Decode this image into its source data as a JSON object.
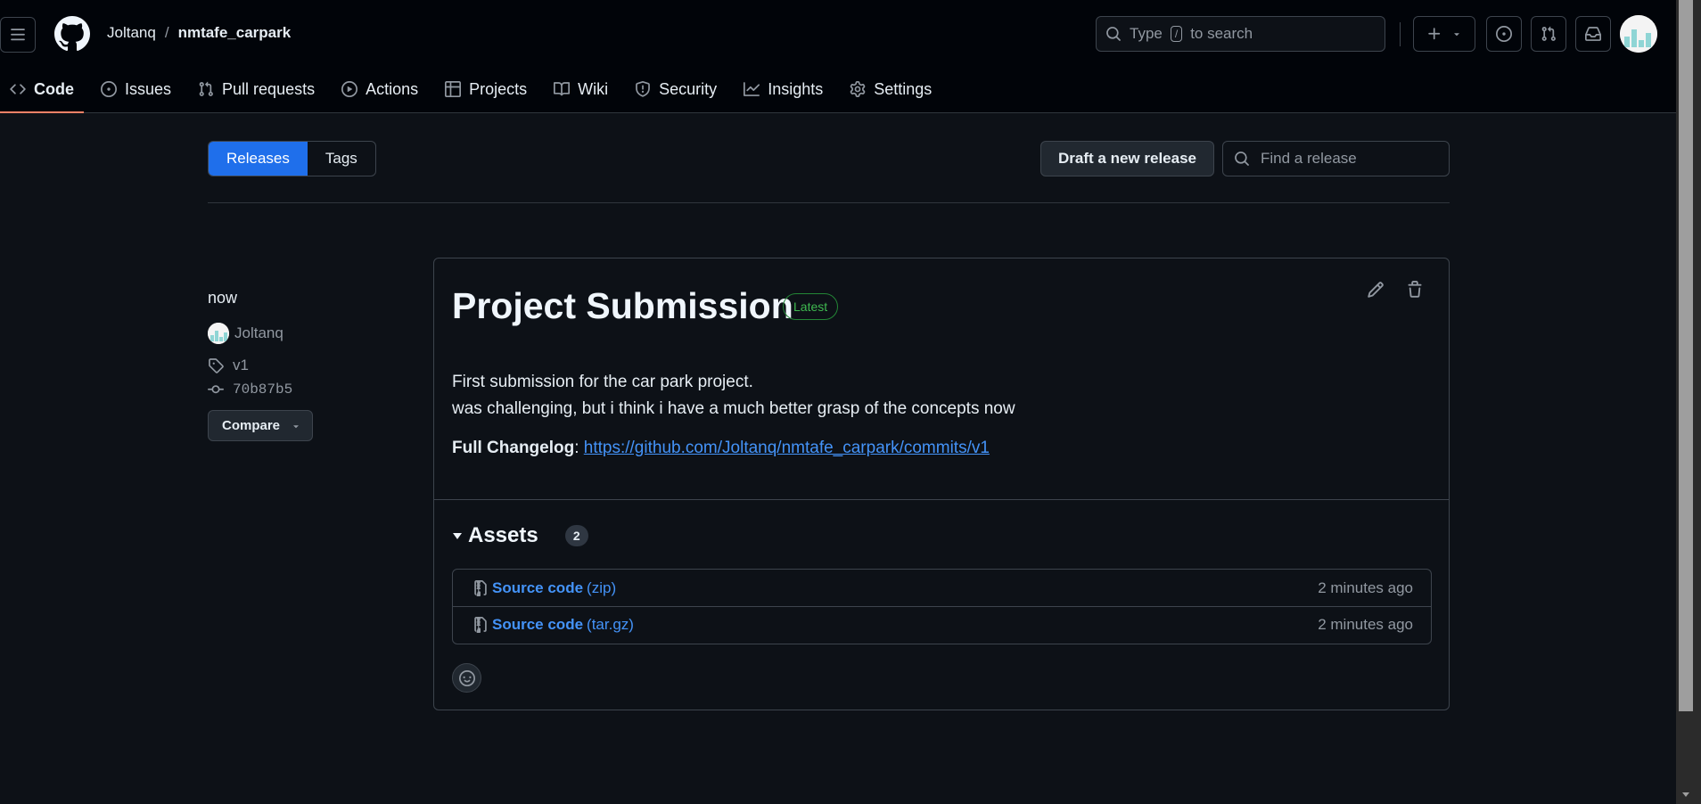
{
  "header": {
    "owner": "Joltanq",
    "separator": "/",
    "repo": "nmtafe_carpark",
    "search_prefix": "Type",
    "search_key": "/",
    "search_suffix": "to search"
  },
  "nav": [
    {
      "label": "Code",
      "icon": "code-icon",
      "active": true
    },
    {
      "label": "Issues",
      "icon": "issue-icon"
    },
    {
      "label": "Pull requests",
      "icon": "pull-request-icon"
    },
    {
      "label": "Actions",
      "icon": "play-icon"
    },
    {
      "label": "Projects",
      "icon": "table-icon"
    },
    {
      "label": "Wiki",
      "icon": "book-icon"
    },
    {
      "label": "Security",
      "icon": "shield-icon"
    },
    {
      "label": "Insights",
      "icon": "graph-icon"
    },
    {
      "label": "Settings",
      "icon": "gear-icon"
    }
  ],
  "subnav": {
    "releases_label": "Releases",
    "tags_label": "Tags",
    "draft_label": "Draft a new release",
    "find_placeholder": "Find a release"
  },
  "release_meta": {
    "when": "now",
    "author": "Joltanq",
    "tag": "v1",
    "commit": "70b87b5",
    "compare_label": "Compare"
  },
  "release": {
    "title": "Project Submission",
    "badge": "Latest",
    "body_line1": "First submission for the car park project.",
    "body_line2": "was challenging, but i think i have a much better grasp of the concepts now",
    "changelog_label": "Full Changelog",
    "changelog_url": "https://github.com/Joltanq/nmtafe_carpark/commits/v1"
  },
  "assets": {
    "title": "Assets",
    "count": "2",
    "items": [
      {
        "name": "Source code",
        "ext": "(zip)",
        "time": "2 minutes ago"
      },
      {
        "name": "Source code",
        "ext": "(tar.gz)",
        "time": "2 minutes ago"
      }
    ]
  },
  "colors": {
    "accent": "#1f6feb",
    "link": "#4493f8",
    "latest": "#3fb950",
    "active_tab": "#f78166"
  }
}
